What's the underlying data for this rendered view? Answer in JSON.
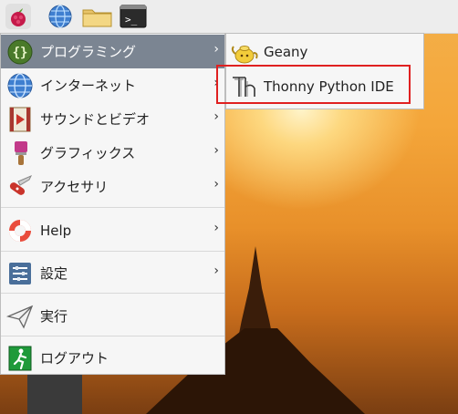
{
  "menu": {
    "items": [
      {
        "label": "プログラミング",
        "icon": "braces-icon",
        "has_submenu": true,
        "selected": true
      },
      {
        "label": "インターネット",
        "icon": "globe-icon",
        "has_submenu": true
      },
      {
        "label": "サウンドとビデオ",
        "icon": "film-icon",
        "has_submenu": true
      },
      {
        "label": "グラフィックス",
        "icon": "paintbrush-icon",
        "has_submenu": true
      },
      {
        "label": "アクセサリ",
        "icon": "pocketknife-icon",
        "has_submenu": true
      },
      {
        "label": "Help",
        "icon": "lifebuoy-icon",
        "has_submenu": true
      },
      {
        "label": "設定",
        "icon": "sliders-icon",
        "has_submenu": true
      },
      {
        "label": "実行",
        "icon": "paperplane-icon",
        "has_submenu": false
      },
      {
        "label": "ログアウト",
        "icon": "exit-icon",
        "has_submenu": false
      }
    ],
    "arrow_glyph": "›"
  },
  "submenu": {
    "items": [
      {
        "label": "Geany",
        "icon": "teapot-icon"
      },
      {
        "label": "Thonny Python IDE",
        "icon": "thonny-icon",
        "highlighted": true
      }
    ]
  },
  "taskbar": {
    "term_glyph": ">_"
  },
  "colors": {
    "selected_bg": "#7b8592",
    "highlight_border": "#e02020"
  }
}
